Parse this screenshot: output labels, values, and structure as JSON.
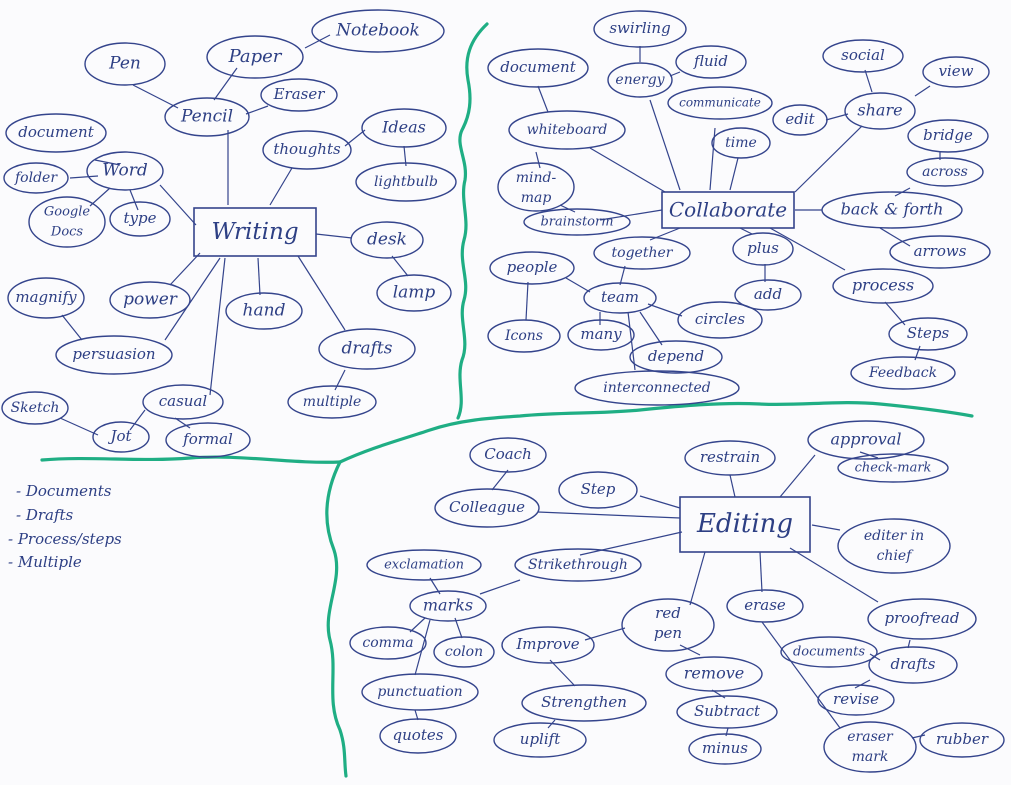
{
  "central": {
    "writing": "Writing",
    "collaborate": "Collaborate",
    "editing": "Editing"
  },
  "nodes": {
    "pen": "Pen",
    "paper": "Paper",
    "notebook": "Notebook",
    "pencil": "Pencil",
    "eraser": "Eraser",
    "thoughts": "thoughts",
    "ideas": "Ideas",
    "lightbulb": "lightbulb",
    "document": "document",
    "folder": "folder",
    "word": "Word",
    "google_docs_1": "Google",
    "google_docs_2": "Docs",
    "type": "type",
    "desk": "desk",
    "lamp": "lamp",
    "magnify": "magnify",
    "power": "power",
    "hand": "hand",
    "persuasion": "persuasion",
    "drafts": "drafts",
    "multiple": "multiple",
    "sketch": "Sketch",
    "jot": "Jot",
    "casual": "casual",
    "formal": "formal",
    "c_document": "document",
    "swirling": "swirling",
    "energy": "energy",
    "fluid": "fluid",
    "whiteboard": "whiteboard",
    "communicate": "communicate",
    "time": "time",
    "social": "social",
    "view": "view",
    "share": "share",
    "edit": "edit",
    "bridge": "bridge",
    "across": "across",
    "mindmap_1": "mind-",
    "mindmap_2": "map",
    "brainstorm": "brainstorm",
    "back_forth": "back & forth",
    "arrows": "arrows",
    "together": "together",
    "plus": "plus",
    "people": "people",
    "team": "team",
    "add": "add",
    "process": "process",
    "icons": "Icons",
    "many": "many",
    "circles": "circles",
    "steps": "Steps",
    "depend": "depend",
    "feedback": "Feedback",
    "interconnected": "interconnected",
    "coach": "Coach",
    "restrain": "restrain",
    "approval": "approval",
    "check_mark": "check-mark",
    "step": "Step",
    "colleague": "Colleague",
    "editor_chief_1": "editer in",
    "editor_chief_2": "chief",
    "exclamation": "exclamation",
    "strikethrough": "Strikethrough",
    "marks": "marks",
    "erase": "erase",
    "red_pen_1": "red",
    "red_pen_2": "pen",
    "proofread": "proofread",
    "comma": "comma",
    "colon": "colon",
    "improve": "Improve",
    "documents": "documents",
    "e_drafts": "drafts",
    "remove": "remove",
    "punctuation": "punctuation",
    "revise": "revise",
    "strengthen": "Strengthen",
    "subtract": "Subtract",
    "quotes": "quotes",
    "uplift": "uplift",
    "minus": "minus",
    "eraser_mark_1": "eraser",
    "eraser_mark_2": "mark",
    "rubber": "rubber"
  },
  "notes": [
    "- Documents",
    "- Drafts",
    "- Process/steps",
    "- Multiple"
  ],
  "colors": {
    "ink": "#2d3f84",
    "divider": "#1fae84",
    "paper": "#fbfbfd"
  }
}
